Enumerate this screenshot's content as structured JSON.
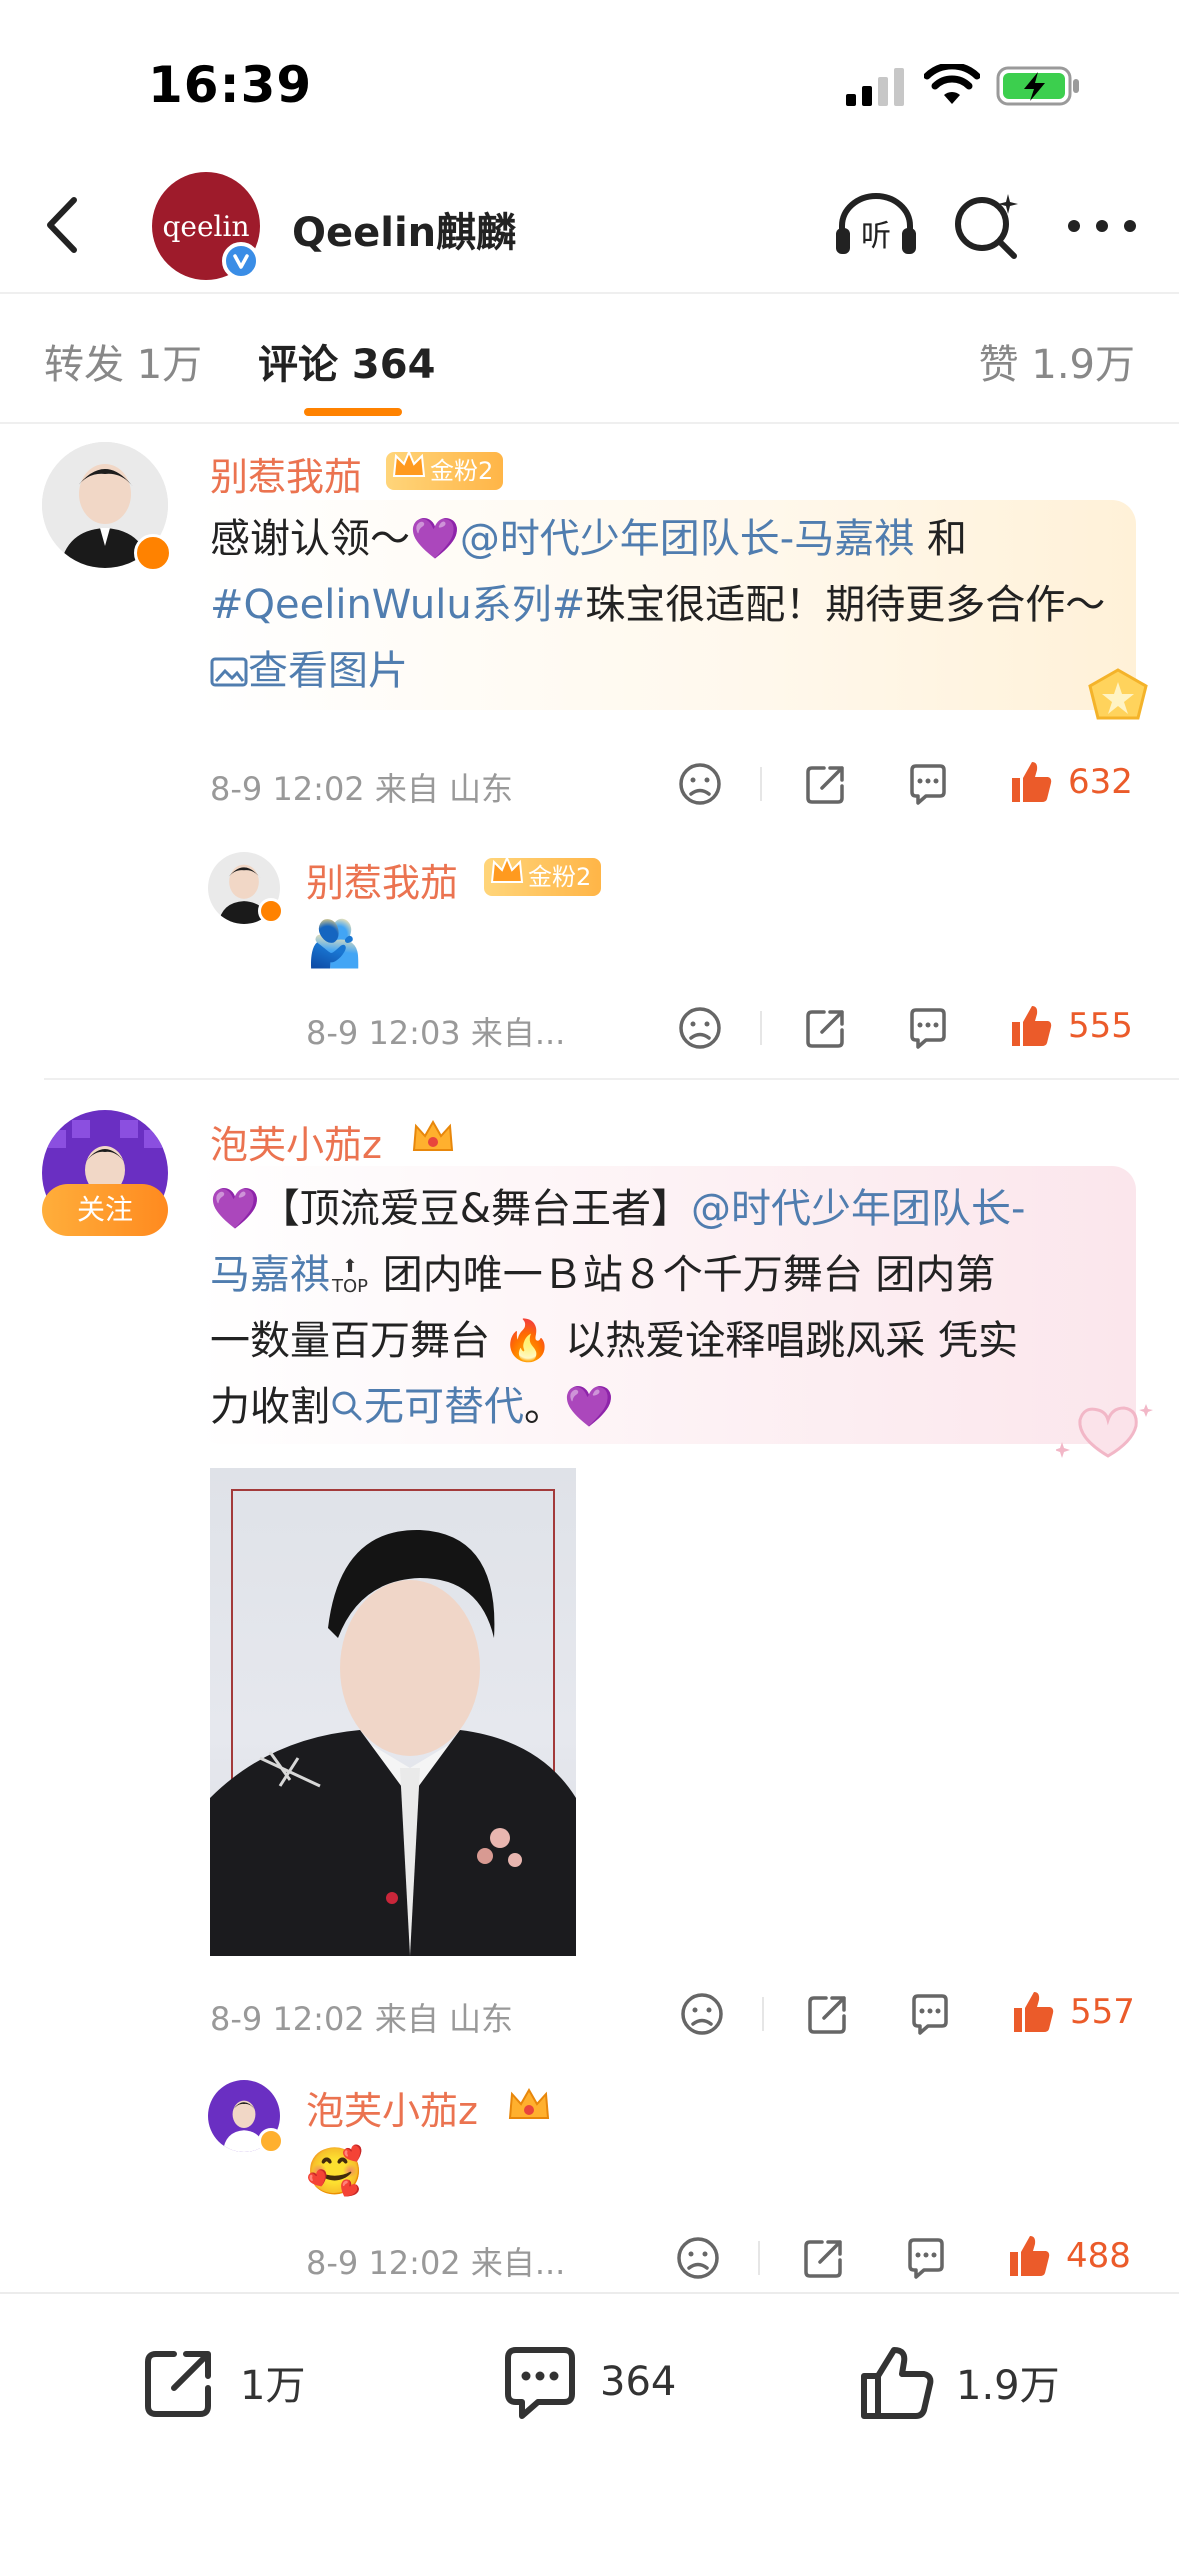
{
  "status_bar": {
    "time": "16:39"
  },
  "header": {
    "avatar_text": "qeelin",
    "account_name": "Qeelin麒麟",
    "listen_label": "听"
  },
  "tabs": {
    "repost": "转发 1万",
    "comment": "评论 364",
    "like": "赞 1.9万"
  },
  "comments": [
    {
      "username": "别惹我茄",
      "fan_badge": "金粉2",
      "text_before": "感谢认领～💜",
      "mention": "@时代少年团队长-马嘉祺",
      "text_mid": " 和",
      "hashtag": "#QeelinWulu系列#",
      "text_after": "珠宝很适配！期待更多合作～ ",
      "view_image": "查看图片",
      "meta": "8-9 12:02  来自 山东",
      "likes": "632",
      "reply": {
        "username": "别惹我茄",
        "fan_badge": "金粉2",
        "emoji": "🫂",
        "meta": "8-9 12:03  来自...",
        "likes": "555"
      }
    },
    {
      "username": "泡芙小茄z",
      "follow_label": "关注",
      "line1_a": "💜【顶流爱豆&舞台王者】",
      "mention": "@时代少年团队长-",
      "line2_mention": "马嘉祺",
      "line2_rest": " 团内唯一Ｂ站８个千万舞台 团内第",
      "line3": "一数量百万舞台 🔥 以热爱诠释唱跳风采 凭实",
      "line4_a": "力收割",
      "search_term": "无可替代",
      "line4_b": "。💜",
      "top_label": "TOP",
      "meta": "8-9 12:02  来自 山东",
      "likes": "557",
      "reply": {
        "username": "泡芙小茄z",
        "emoji": "🥰",
        "meta": "8-9 12:02  来自...",
        "likes": "488"
      }
    }
  ],
  "bottom_bar": {
    "repost_count": "1万",
    "comment_count": "364",
    "like_count": "1.9万"
  },
  "colors": {
    "accent": "#ff8200",
    "username": "#eb7350",
    "link": "#507daf",
    "like": "#eb5b2a"
  }
}
